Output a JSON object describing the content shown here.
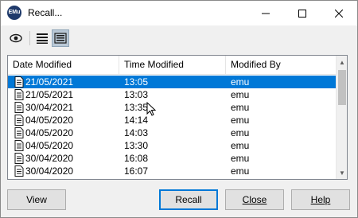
{
  "window": {
    "title": "Recall...",
    "app_icon_text": "EMu"
  },
  "toolbar": {
    "icons": [
      "eye-icon",
      "list-view-icon",
      "detail-view-icon"
    ],
    "active": "detail-view-icon"
  },
  "list": {
    "columns": [
      "Date Modified",
      "Time Modified",
      "Modified By"
    ],
    "rows": [
      {
        "date": "21/05/2021",
        "time": "13:05",
        "by": "emu",
        "selected": true
      },
      {
        "date": "21/05/2021",
        "time": "13:03",
        "by": "emu",
        "selected": false
      },
      {
        "date": "30/04/2021",
        "time": "13:35",
        "by": "emu",
        "selected": false
      },
      {
        "date": "04/05/2020",
        "time": "14:14",
        "by": "emu",
        "selected": false
      },
      {
        "date": "04/05/2020",
        "time": "14:03",
        "by": "emu",
        "selected": false
      },
      {
        "date": "04/05/2020",
        "time": "13:30",
        "by": "emu",
        "selected": false
      },
      {
        "date": "30/04/2020",
        "time": "16:08",
        "by": "emu",
        "selected": false
      },
      {
        "date": "30/04/2020",
        "time": "16:07",
        "by": "emu",
        "selected": false
      }
    ]
  },
  "buttons": {
    "view": "View",
    "recall": "Recall",
    "close": "Close",
    "help": "Help"
  },
  "colors": {
    "selection": "#0078d7",
    "default_button_border": "#0078d7"
  }
}
